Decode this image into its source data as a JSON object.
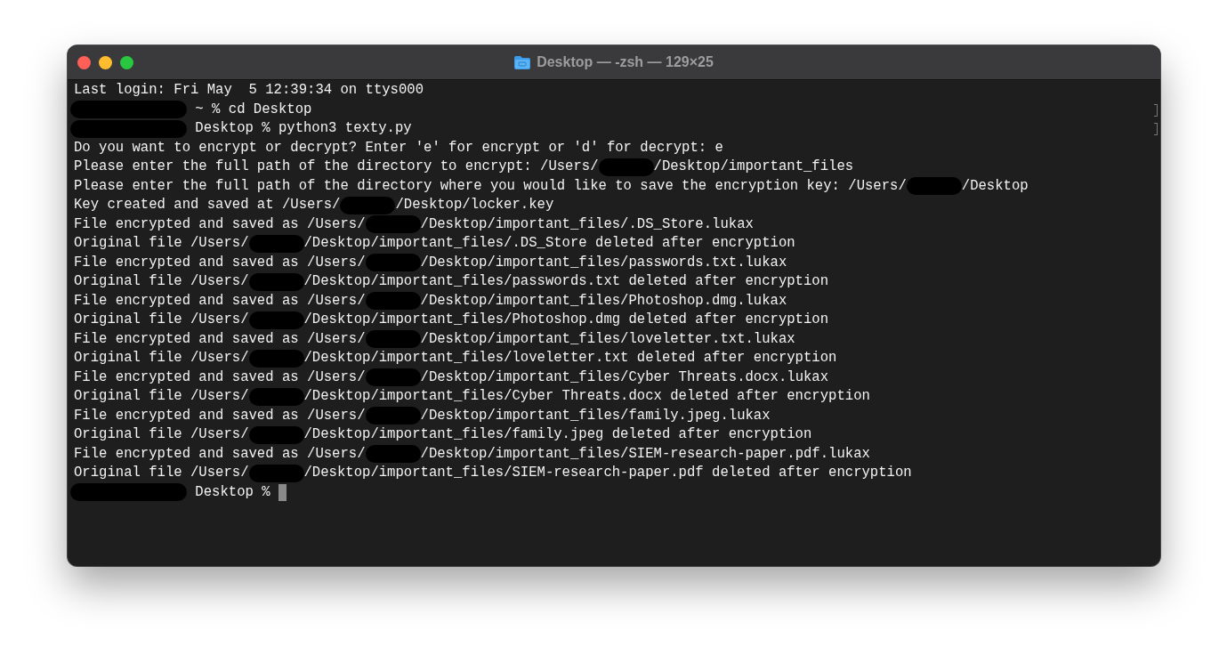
{
  "window": {
    "title": "Desktop — -zsh — 129×25"
  },
  "terminal": {
    "lines": [
      {
        "marked": false,
        "segments": [
          {
            "kind": "text",
            "text": "Last login: Fri May  5 12:39:34 on ttys000"
          }
        ]
      },
      {
        "marked": true,
        "segments": [
          {
            "kind": "prompt_redacted"
          },
          {
            "kind": "text",
            "text": " ~ % cd Desktop"
          }
        ]
      },
      {
        "marked": true,
        "segments": [
          {
            "kind": "prompt_redacted"
          },
          {
            "kind": "text",
            "text": " Desktop % python3 texty.py"
          }
        ]
      },
      {
        "marked": false,
        "segments": [
          {
            "kind": "text",
            "text": "Do you want to encrypt or decrypt? Enter 'e' for encrypt or 'd' for decrypt: e"
          }
        ]
      },
      {
        "marked": false,
        "segments": [
          {
            "kind": "text",
            "text": "Please enter the full path of the directory to encrypt: /Users/"
          },
          {
            "kind": "user_redacted"
          },
          {
            "kind": "text",
            "text": "/Desktop/important_files"
          }
        ]
      },
      {
        "marked": false,
        "segments": [
          {
            "kind": "text",
            "text": "Please enter the full path of the directory where you would like to save the encryption key: /Users/"
          },
          {
            "kind": "user_redacted"
          },
          {
            "kind": "text",
            "text": "/Desktop"
          }
        ]
      },
      {
        "marked": false,
        "segments": [
          {
            "kind": "text",
            "text": "Key created and saved at /Users/"
          },
          {
            "kind": "user_redacted"
          },
          {
            "kind": "text",
            "text": "/Desktop/locker.key"
          }
        ]
      },
      {
        "marked": false,
        "segments": [
          {
            "kind": "text",
            "text": "File encrypted and saved as /Users/"
          },
          {
            "kind": "user_redacted"
          },
          {
            "kind": "text",
            "text": "/Desktop/important_files/.DS_Store.lukax"
          }
        ]
      },
      {
        "marked": false,
        "segments": [
          {
            "kind": "text",
            "text": "Original file /Users/"
          },
          {
            "kind": "user_redacted"
          },
          {
            "kind": "text",
            "text": "/Desktop/important_files/.DS_Store deleted after encryption"
          }
        ]
      },
      {
        "marked": false,
        "segments": [
          {
            "kind": "text",
            "text": "File encrypted and saved as /Users/"
          },
          {
            "kind": "user_redacted"
          },
          {
            "kind": "text",
            "text": "/Desktop/important_files/passwords.txt.lukax"
          }
        ]
      },
      {
        "marked": false,
        "segments": [
          {
            "kind": "text",
            "text": "Original file /Users/"
          },
          {
            "kind": "user_redacted"
          },
          {
            "kind": "text",
            "text": "/Desktop/important_files/passwords.txt deleted after encryption"
          }
        ]
      },
      {
        "marked": false,
        "segments": [
          {
            "kind": "text",
            "text": "File encrypted and saved as /Users/"
          },
          {
            "kind": "user_redacted"
          },
          {
            "kind": "text",
            "text": "/Desktop/important_files/Photoshop.dmg.lukax"
          }
        ]
      },
      {
        "marked": false,
        "segments": [
          {
            "kind": "text",
            "text": "Original file /Users/"
          },
          {
            "kind": "user_redacted"
          },
          {
            "kind": "text",
            "text": "/Desktop/important_files/Photoshop.dmg deleted after encryption"
          }
        ]
      },
      {
        "marked": false,
        "segments": [
          {
            "kind": "text",
            "text": "File encrypted and saved as /Users/"
          },
          {
            "kind": "user_redacted"
          },
          {
            "kind": "text",
            "text": "/Desktop/important_files/loveletter.txt.lukax"
          }
        ]
      },
      {
        "marked": false,
        "segments": [
          {
            "kind": "text",
            "text": "Original file /Users/"
          },
          {
            "kind": "user_redacted"
          },
          {
            "kind": "text",
            "text": "/Desktop/important_files/loveletter.txt deleted after encryption"
          }
        ]
      },
      {
        "marked": false,
        "segments": [
          {
            "kind": "text",
            "text": "File encrypted and saved as /Users/"
          },
          {
            "kind": "user_redacted"
          },
          {
            "kind": "text",
            "text": "/Desktop/important_files/Cyber Threats.docx.lukax"
          }
        ]
      },
      {
        "marked": false,
        "segments": [
          {
            "kind": "text",
            "text": "Original file /Users/"
          },
          {
            "kind": "user_redacted"
          },
          {
            "kind": "text",
            "text": "/Desktop/important_files/Cyber Threats.docx deleted after encryption"
          }
        ]
      },
      {
        "marked": false,
        "segments": [
          {
            "kind": "text",
            "text": "File encrypted and saved as /Users/"
          },
          {
            "kind": "user_redacted"
          },
          {
            "kind": "text",
            "text": "/Desktop/important_files/family.jpeg.lukax"
          }
        ]
      },
      {
        "marked": false,
        "segments": [
          {
            "kind": "text",
            "text": "Original file /Users/"
          },
          {
            "kind": "user_redacted"
          },
          {
            "kind": "text",
            "text": "/Desktop/important_files/family.jpeg deleted after encryption"
          }
        ]
      },
      {
        "marked": false,
        "segments": [
          {
            "kind": "text",
            "text": "File encrypted and saved as /Users/"
          },
          {
            "kind": "user_redacted"
          },
          {
            "kind": "text",
            "text": "/Desktop/important_files/SIEM-research-paper.pdf.lukax"
          }
        ]
      },
      {
        "marked": false,
        "segments": [
          {
            "kind": "text",
            "text": "Original file /Users/"
          },
          {
            "kind": "user_redacted"
          },
          {
            "kind": "text",
            "text": "/Desktop/important_files/SIEM-research-paper.pdf deleted after encryption"
          }
        ]
      },
      {
        "marked": false,
        "segments": [
          {
            "kind": "prompt_redacted"
          },
          {
            "kind": "text",
            "text": " Desktop % "
          },
          {
            "kind": "cursor"
          }
        ]
      }
    ]
  }
}
